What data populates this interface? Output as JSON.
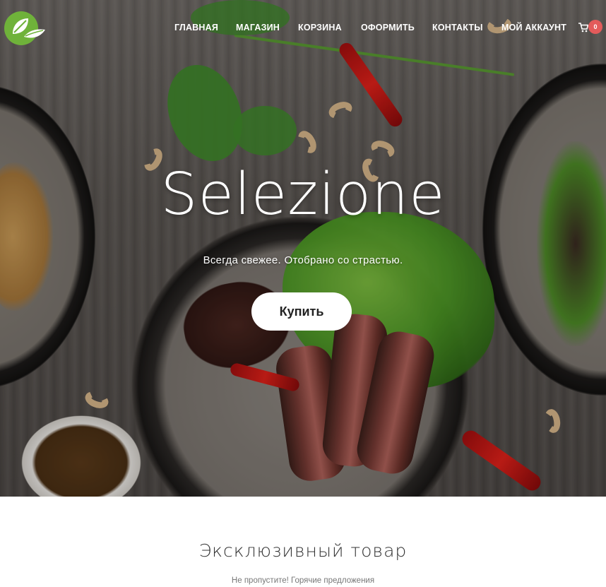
{
  "header": {
    "nav": [
      {
        "label": "ГЛАВНАЯ"
      },
      {
        "label": "МАГАЗИН"
      },
      {
        "label": "КОРЗИНА"
      },
      {
        "label": "ОФОРМИТЬ"
      },
      {
        "label": "КОНТАКТЫ"
      },
      {
        "label": "МОЙ АККАУНТ"
      }
    ],
    "cart_count": "0",
    "logo_icon": "leaf-logo-icon",
    "cart_icon": "cart-icon"
  },
  "hero": {
    "title": "Selezione",
    "subtitle": "Всегда свежее. Отобрано со страстью.",
    "button_label": "Купить"
  },
  "section": {
    "title": "Эксклюзивный товар",
    "subtitle": "Не пропустите! Горячие предложения"
  },
  "colors": {
    "brand_green": "#6fb23a",
    "badge_red": "#e35b5b",
    "button_bg": "#ffffff"
  }
}
